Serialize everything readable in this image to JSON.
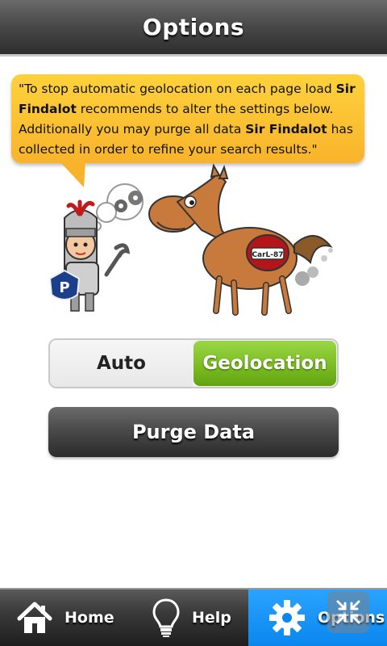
{
  "header": {
    "title": "Options"
  },
  "bubble": {
    "part1": "\"To stop automatic geolocation on each page load ",
    "brand1": "Sir Findalot",
    "part2": " recommends to alter the settings below. Additionally you may purge all data ",
    "brand2": "Sir Findalot",
    "part3": " has collected in order to refine your search results.\""
  },
  "illustration": {
    "parking_badge": "P",
    "horse_tag": "CarL-87"
  },
  "mode_toggle": {
    "auto_label": "Auto",
    "geolocation_label": "Geolocation",
    "selected": "Geolocation"
  },
  "purge": {
    "label": "Purge Data"
  },
  "tabbar": {
    "tabs": [
      {
        "label": "Home",
        "icon": "home-icon"
      },
      {
        "label": "Help",
        "icon": "lightbulb-icon"
      },
      {
        "label": "Options",
        "icon": "gear-icon",
        "active": true
      }
    ]
  },
  "overlay": {
    "icon": "collapse-arrows-icon"
  },
  "colors": {
    "active_tab": "#0a86ee",
    "toggle_on": "#7dbd23",
    "bubble": "#f9b32b"
  }
}
